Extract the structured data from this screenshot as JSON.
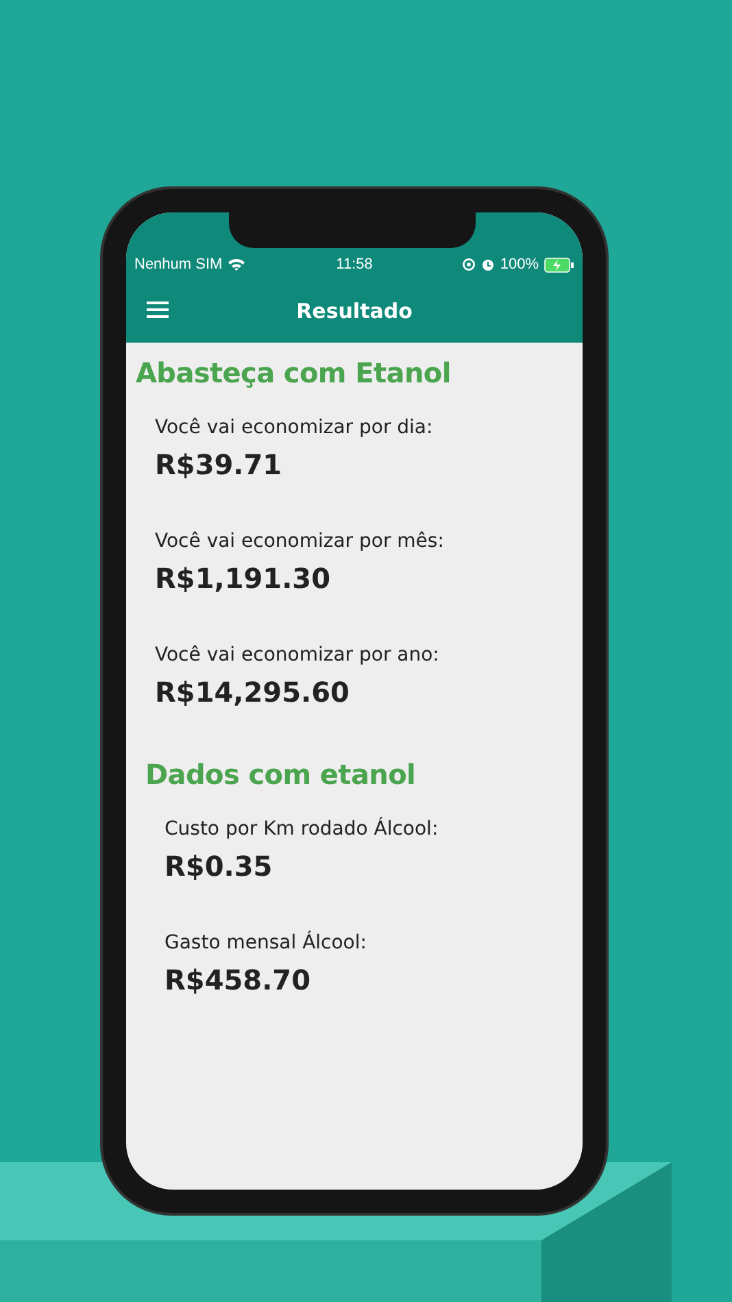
{
  "status_bar": {
    "carrier": "Nenhum SIM",
    "time": "11:58",
    "battery": "100%"
  },
  "app_bar": {
    "title": "Resultado"
  },
  "sections": [
    {
      "title": "Abasteça com Etanol",
      "items": [
        {
          "label": "Você vai economizar por dia:",
          "value": "R$39.71"
        },
        {
          "label": "Você vai economizar por mês:",
          "value": "R$1,191.30"
        },
        {
          "label": "Você vai economizar por ano:",
          "value": "R$14,295.60"
        }
      ]
    },
    {
      "title": "Dados com etanol",
      "items": [
        {
          "label": "Custo por Km rodado Álcool:",
          "value": "R$0.35"
        },
        {
          "label": "Gasto mensal Álcool:",
          "value": "R$458.70"
        }
      ]
    }
  ]
}
